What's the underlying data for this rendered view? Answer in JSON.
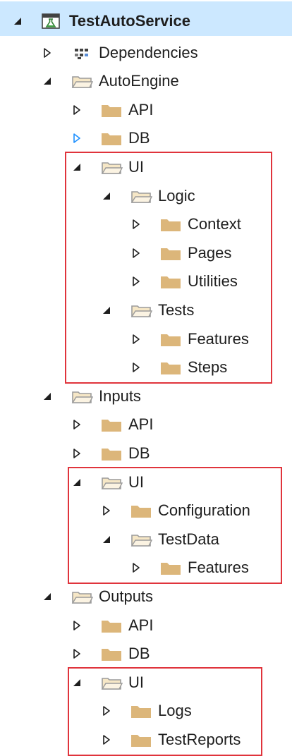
{
  "solution_explorer": {
    "nodes": [
      {
        "label": "TestAutoService",
        "level": 0,
        "icon": "test-project-icon",
        "expander": "expanded",
        "selected": true,
        "bold": true
      },
      {
        "label": "Dependencies",
        "level": 1,
        "icon": "dependencies-icon",
        "expander": "collapsed"
      },
      {
        "label": "AutoEngine",
        "level": 1,
        "icon": "folder-open-icon",
        "expander": "expanded"
      },
      {
        "label": "API",
        "level": 2,
        "icon": "folder-icon",
        "expander": "collapsed"
      },
      {
        "label": "DB",
        "level": 2,
        "icon": "folder-icon",
        "expander": "collapsed-hover"
      },
      {
        "label": "UI",
        "level": 2,
        "icon": "folder-open-icon",
        "expander": "expanded"
      },
      {
        "label": "Logic",
        "level": 3,
        "icon": "folder-open-icon",
        "expander": "expanded"
      },
      {
        "label": "Context",
        "level": 4,
        "icon": "folder-icon",
        "expander": "collapsed"
      },
      {
        "label": "Pages",
        "level": 4,
        "icon": "folder-icon",
        "expander": "collapsed"
      },
      {
        "label": "Utilities",
        "level": 4,
        "icon": "folder-icon",
        "expander": "collapsed"
      },
      {
        "label": "Tests",
        "level": 3,
        "icon": "folder-open-icon",
        "expander": "expanded"
      },
      {
        "label": "Features",
        "level": 4,
        "icon": "folder-icon",
        "expander": "collapsed"
      },
      {
        "label": "Steps",
        "level": 4,
        "icon": "folder-icon",
        "expander": "collapsed"
      },
      {
        "label": "Inputs",
        "level": 1,
        "icon": "folder-open-icon",
        "expander": "expanded"
      },
      {
        "label": "API",
        "level": 2,
        "icon": "folder-icon",
        "expander": "collapsed"
      },
      {
        "label": "DB",
        "level": 2,
        "icon": "folder-icon",
        "expander": "collapsed"
      },
      {
        "label": "UI",
        "level": 2,
        "icon": "folder-open-icon",
        "expander": "expanded"
      },
      {
        "label": "Configuration",
        "level": 3,
        "icon": "folder-icon",
        "expander": "collapsed"
      },
      {
        "label": "TestData",
        "level": 3,
        "icon": "folder-open-icon",
        "expander": "expanded"
      },
      {
        "label": "Features",
        "level": 4,
        "icon": "folder-icon",
        "expander": "collapsed"
      },
      {
        "label": "Outputs",
        "level": 1,
        "icon": "folder-open-icon",
        "expander": "expanded"
      },
      {
        "label": "API",
        "level": 2,
        "icon": "folder-icon",
        "expander": "collapsed"
      },
      {
        "label": "DB",
        "level": 2,
        "icon": "folder-icon",
        "expander": "collapsed"
      },
      {
        "label": "UI",
        "level": 2,
        "icon": "folder-open-icon",
        "expander": "expanded"
      },
      {
        "label": "Logs",
        "level": 3,
        "icon": "folder-icon",
        "expander": "collapsed"
      },
      {
        "label": "TestReports",
        "level": 3,
        "icon": "folder-icon",
        "expander": "collapsed"
      }
    ],
    "highlight_groups": [
      {
        "name": "autoengine-ui",
        "from_node": 5,
        "to_node": 12
      },
      {
        "name": "inputs-ui",
        "from_node": 16,
        "to_node": 19
      },
      {
        "name": "outputs-ui",
        "from_node": 23,
        "to_node": 25
      }
    ]
  },
  "colors": {
    "folder": "#dcb67a",
    "folder_open_outline": "#9b9b9b",
    "expander": "#1e1e1e",
    "expander_hover": "#1e90ff",
    "selection": "#cce8ff",
    "highlight_border": "#e0343c",
    "text": "#1e1e1e"
  }
}
